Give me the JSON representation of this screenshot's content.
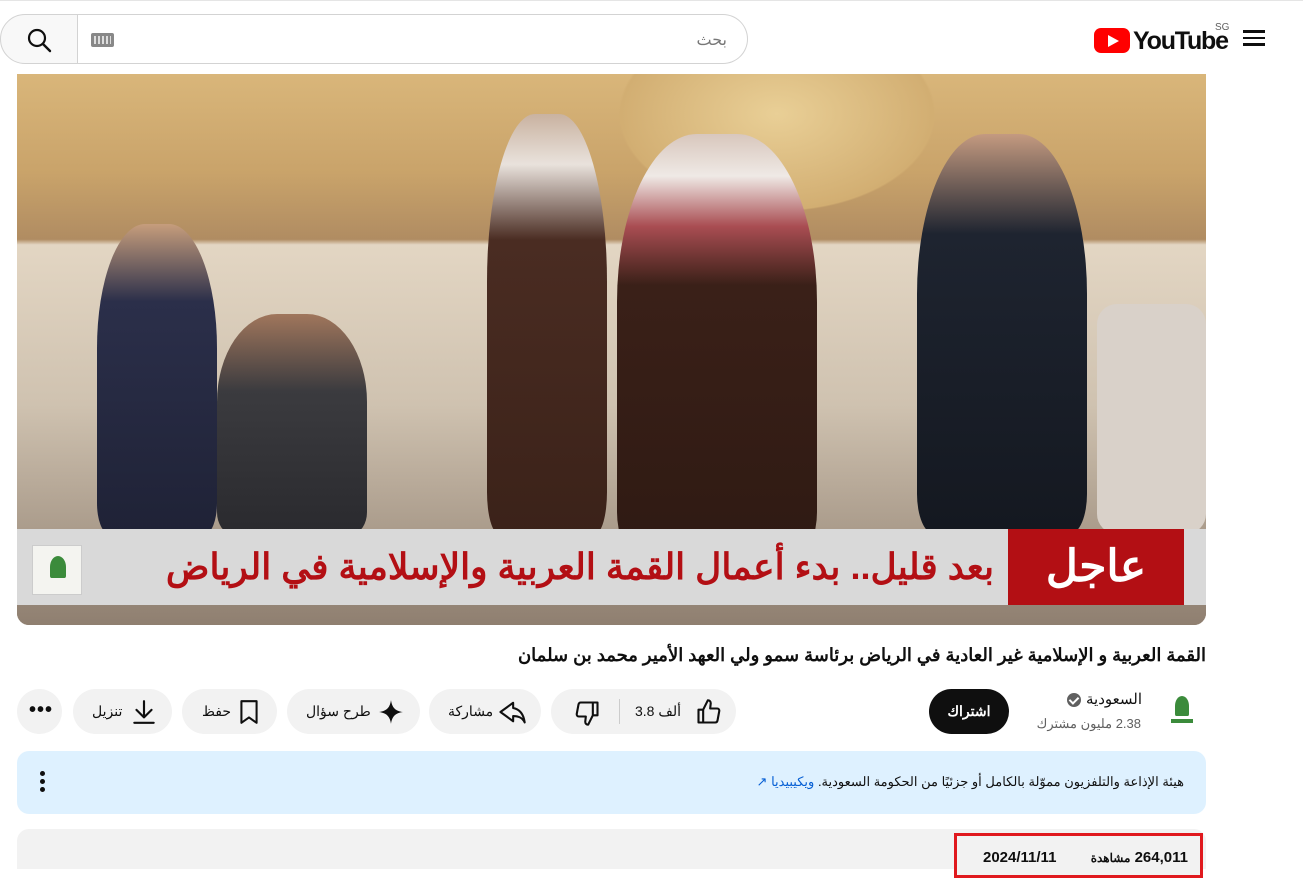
{
  "header": {
    "logo_text": "YouTube",
    "region": "SG",
    "search_placeholder": "بحث"
  },
  "video": {
    "breaking_label": "عاجل",
    "ticker_text": "بعد قليل.. بدء أعمال القمة العربية والإسلامية في الرياض",
    "title": "القمة العربية و الإسلامية غير العادية في الرياض برئاسة سمو ولي العهد الأمير محمد بن سلمان"
  },
  "channel": {
    "name": "السعودية",
    "subscribers": "2.38 مليون مشترك",
    "subscribe_label": "اشتراك"
  },
  "actions": {
    "like_count": "3.8 ألف",
    "share_label": "مشاركة",
    "ask_label": "طرح سؤال",
    "save_label": "حفظ",
    "download_label": "تنزيل"
  },
  "info_panel": {
    "text": "هيئة الإذاعة والتلفزيون مموّلة بالكامل أو جزئيًا من الحكومة السعودية.",
    "link": "ويكيبيديا"
  },
  "description": {
    "views": "264,011",
    "views_label": "مشاهدة",
    "date": "2024/11/11"
  },
  "colors": {
    "brand_red": "#ff0000",
    "breaking_red": "#b30f14",
    "highlight_box": "#e0191e",
    "info_bg": "#def1ff"
  }
}
